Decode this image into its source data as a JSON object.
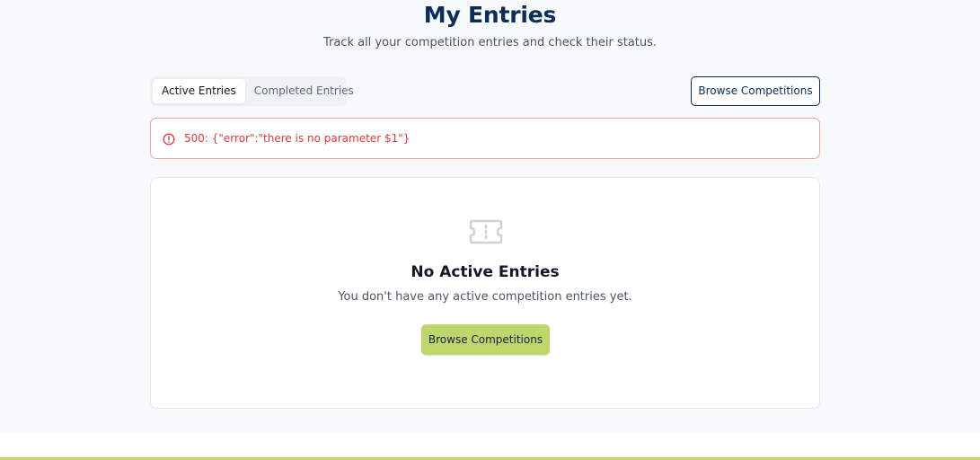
{
  "header": {
    "title": "My Entries",
    "subtitle": "Track all your competition entries and check their status."
  },
  "tabs": [
    {
      "label": "Active Entries",
      "active": true
    },
    {
      "label": "Completed Entries",
      "active": false
    }
  ],
  "toolbar": {
    "browse_label": "Browse Competitions"
  },
  "alert": {
    "icon": "alert-circle-icon",
    "message": "500: {\"error\":\"there is no parameter $1\"}",
    "color": "#dc3b3b"
  },
  "empty_state": {
    "icon": "ticket-icon",
    "title": "No Active Entries",
    "description": "You don't have any active competition entries yet.",
    "button_label": "Browse Competitions"
  },
  "colors": {
    "brand_navy": "#0b2d57",
    "accent_lime": "#bfd66c",
    "error_red": "#dc3b3b"
  }
}
